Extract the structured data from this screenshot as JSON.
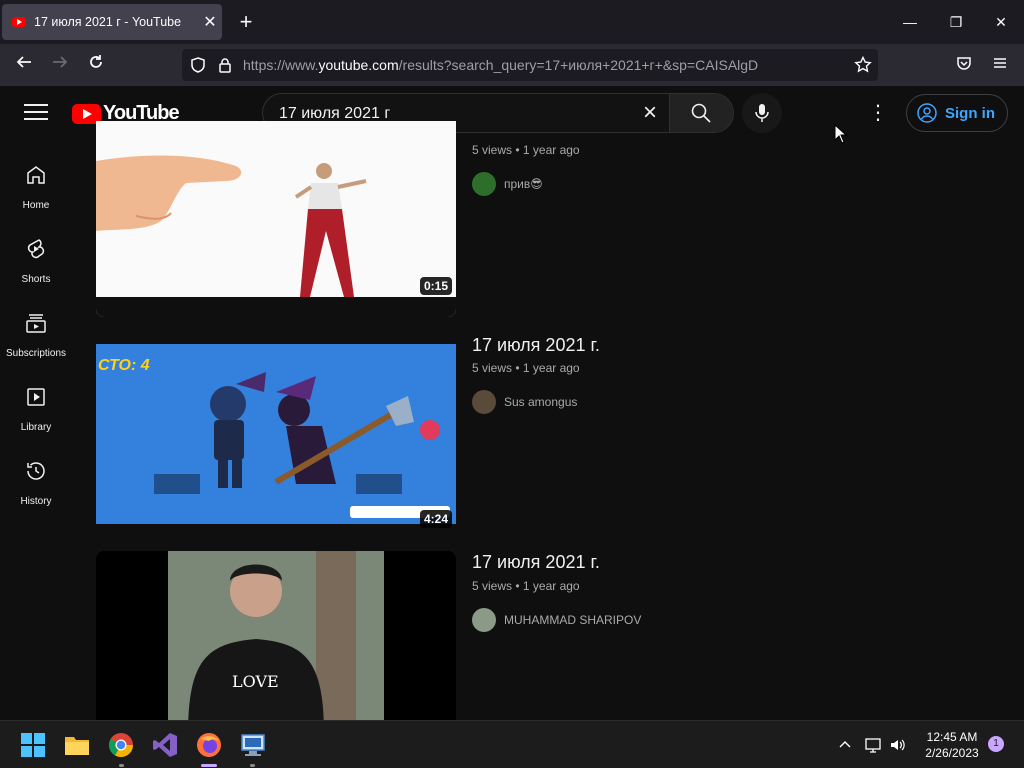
{
  "browser": {
    "tab_title": "17 июля 2021 г - YouTube",
    "new_tab": "+",
    "url_prefix": "https://www.",
    "url_domain": "youtube.com",
    "url_rest": "/results?search_query=17+июля+2021+г+&sp=CAISAlgD"
  },
  "youtube": {
    "logo_text": "YouTube",
    "search_query": "17 июля 2021 г",
    "signin_label": "Sign in"
  },
  "sidebar": {
    "items": [
      {
        "label": "Home",
        "icon": "home-icon"
      },
      {
        "label": "Shorts",
        "icon": "shorts-icon"
      },
      {
        "label": "Subscriptions",
        "icon": "subscriptions-icon"
      },
      {
        "label": "Library",
        "icon": "library-icon"
      },
      {
        "label": "History",
        "icon": "history-icon"
      }
    ]
  },
  "results": [
    {
      "title": "",
      "meta": "5 views • 1 year ago",
      "channel": "прив😎",
      "duration": "0:15"
    },
    {
      "title": "17 июля 2021 г.",
      "meta": "5 views • 1 year ago",
      "channel": "Sus amongus",
      "duration": "4:24"
    },
    {
      "title": "17 июля 2021 г.",
      "meta": "5 views • 1 year ago",
      "channel": "MUHAMMAD SHARIPOV",
      "duration": ""
    }
  ],
  "taskbar": {
    "time": "12:45 AM",
    "date": "2/26/2023",
    "notifications": "1"
  },
  "colors": {
    "youtube_red": "#ff0000",
    "signin_blue": "#3ea6ff",
    "background": "#0f0f0f"
  }
}
